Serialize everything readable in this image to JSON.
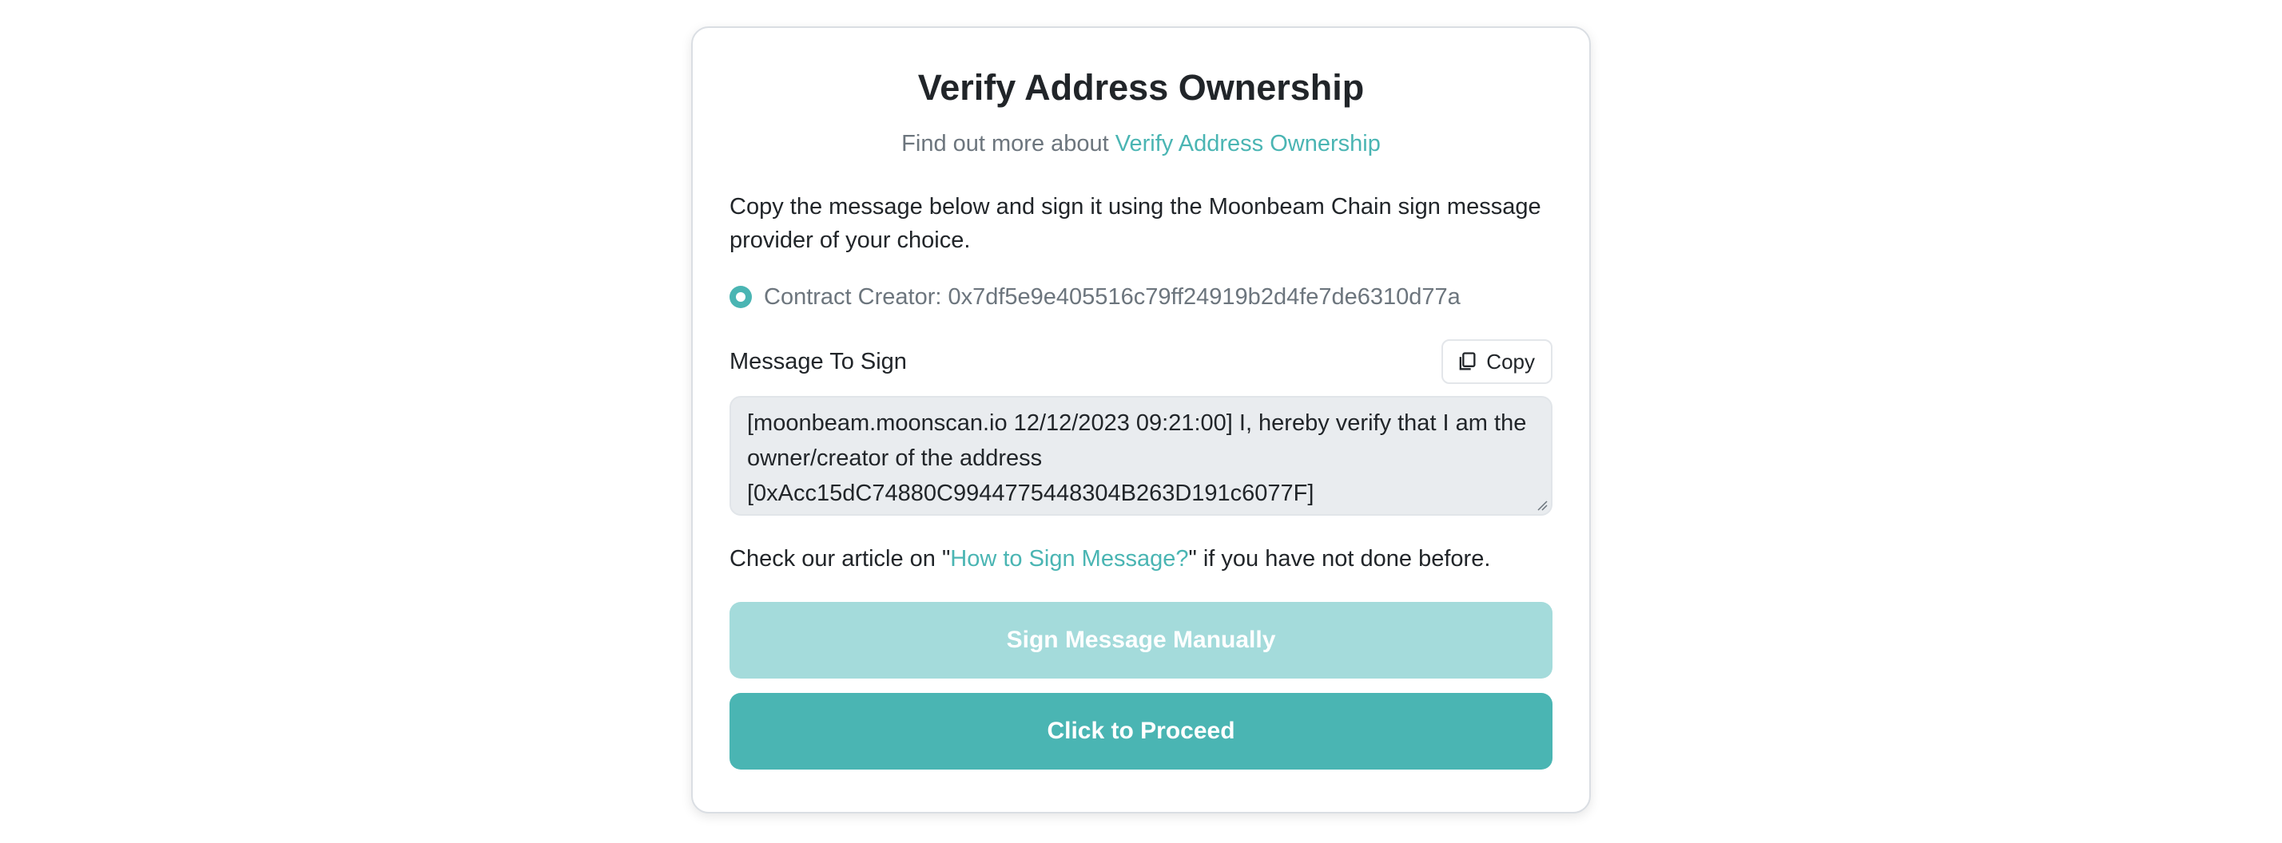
{
  "card": {
    "title": "Verify Address Ownership",
    "subtitle_prefix": "Find out more about ",
    "subtitle_link": "Verify Address Ownership",
    "intro": "Copy the message below and sign it using the Moonbeam Chain sign message provider of your choice.",
    "radio_label": "Contract Creator: 0x7df5e9e405516c79ff24919b2d4fe7de6310d77a",
    "message_label": "Message To Sign",
    "copy_label": "Copy",
    "message_text": "[moonbeam.moonscan.io 12/12/2023 09:21:00] I, hereby verify that I am the owner/creator of the address [0xAcc15dC74880C9944775448304B263D191c6077F]",
    "article_prefix": "Check our article on \"",
    "article_link": "How to Sign Message?",
    "article_suffix": "\" if you have not done before.",
    "sign_manual_label": "Sign Message Manually",
    "proceed_label": "Click to Proceed"
  },
  "colors": {
    "accent": "#4ab5b3",
    "accent_disabled": "#a4dbdb",
    "muted_text": "#6c757d",
    "message_bg": "#e9ecef"
  },
  "icons": {
    "copy": "copy-icon",
    "radio": "radio-selected-icon"
  }
}
